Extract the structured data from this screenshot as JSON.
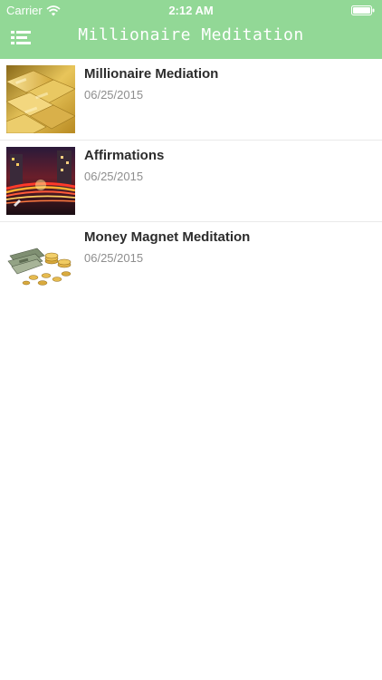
{
  "status_bar": {
    "carrier": "Carrier",
    "time": "2:12 AM",
    "wifi_icon": "wifi-icon",
    "battery_icon": "battery-icon"
  },
  "nav": {
    "title": "Millionaire Meditation",
    "menu_icon": "menu-list-icon"
  },
  "colors": {
    "header_background": "#92d896",
    "title_text": "#2c2c2c",
    "date_text": "#8e8e8e",
    "separator": "#e9e9e9"
  },
  "items": [
    {
      "title": "Millionaire Mediation",
      "date": "06/25/2015",
      "thumbnail": "gold-bars-image"
    },
    {
      "title": "Affirmations",
      "date": "06/25/2015",
      "thumbnail": "city-lights-image"
    },
    {
      "title": "Money Magnet Meditation",
      "date": "06/25/2015",
      "thumbnail": "money-coins-image"
    }
  ]
}
